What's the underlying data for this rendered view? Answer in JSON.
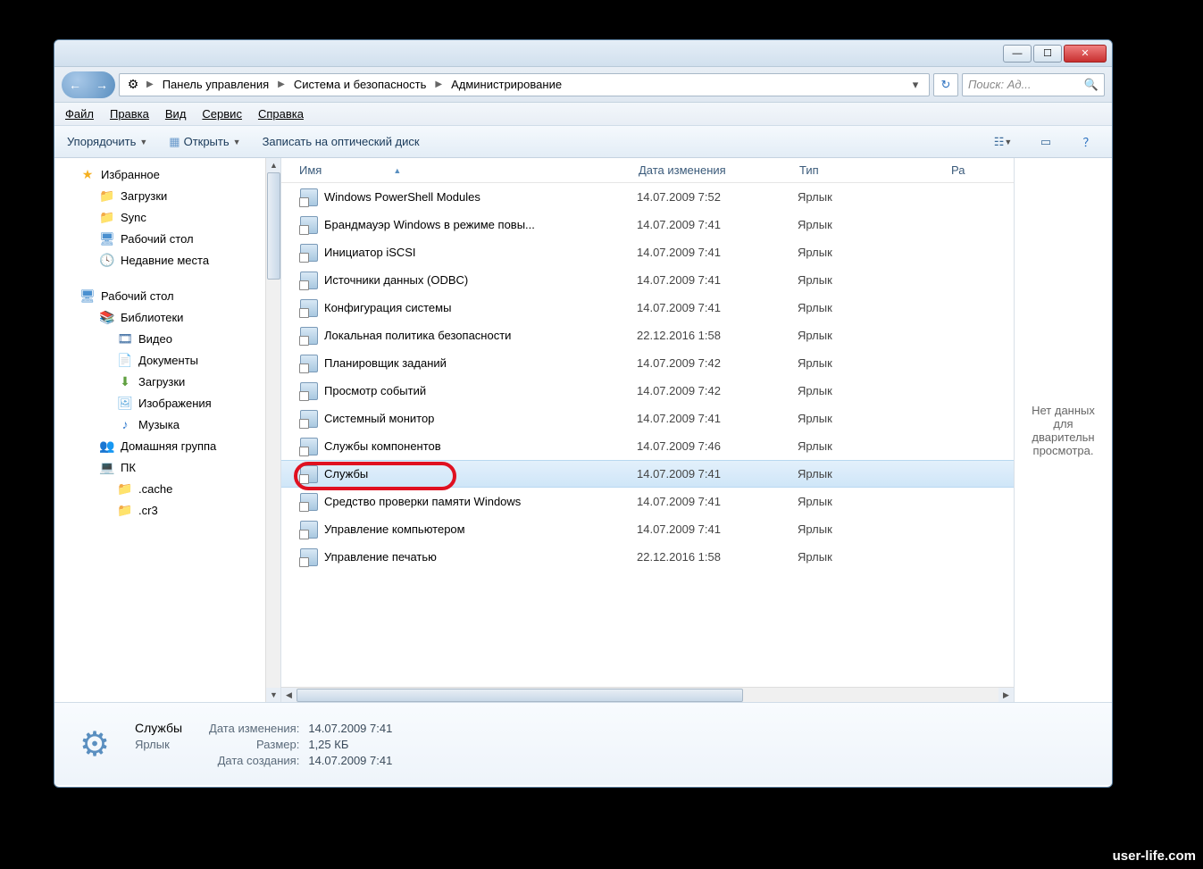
{
  "breadcrumb": {
    "seg1": "Панель управления",
    "seg2": "Система и безопасность",
    "seg3": "Администрирование"
  },
  "search": {
    "placeholder": "Поиск: Ад..."
  },
  "menu": {
    "file": "Файл",
    "edit": "Правка",
    "view": "Вид",
    "service": "Сервис",
    "help": "Справка"
  },
  "toolbar": {
    "organize": "Упорядочить",
    "open": "Открыть",
    "burn": "Записать на оптический диск"
  },
  "columns": {
    "name": "Имя",
    "date": "Дата изменения",
    "type": "Тип",
    "size": "Ра"
  },
  "sidebar": {
    "fav": "Избранное",
    "dl": "Загрузки",
    "sync": "Sync",
    "desk": "Рабочий стол",
    "recent": "Недавние места",
    "desk2": "Рабочий стол",
    "lib": "Библиотеки",
    "vid": "Видео",
    "doc": "Документы",
    "dl2": "Загрузки",
    "img": "Изображения",
    "mus": "Музыка",
    "hg": "Домашняя группа",
    "pc": "ПК",
    "cache": ".cache",
    "cr3": ".cr3"
  },
  "files": [
    {
      "name": "Windows PowerShell Modules",
      "date": "14.07.2009 7:52",
      "type": "Ярлык"
    },
    {
      "name": "Брандмауэр Windows в режиме повы...",
      "date": "14.07.2009 7:41",
      "type": "Ярлык"
    },
    {
      "name": "Инициатор iSCSI",
      "date": "14.07.2009 7:41",
      "type": "Ярлык"
    },
    {
      "name": "Источники данных (ODBC)",
      "date": "14.07.2009 7:41",
      "type": "Ярлык"
    },
    {
      "name": "Конфигурация системы",
      "date": "14.07.2009 7:41",
      "type": "Ярлык"
    },
    {
      "name": "Локальная политика безопасности",
      "date": "22.12.2016 1:58",
      "type": "Ярлык"
    },
    {
      "name": "Планировщик заданий",
      "date": "14.07.2009 7:42",
      "type": "Ярлык"
    },
    {
      "name": "Просмотр событий",
      "date": "14.07.2009 7:42",
      "type": "Ярлык"
    },
    {
      "name": "Системный монитор",
      "date": "14.07.2009 7:41",
      "type": "Ярлык"
    },
    {
      "name": "Службы компонентов",
      "date": "14.07.2009 7:46",
      "type": "Ярлык"
    },
    {
      "name": "Службы",
      "date": "14.07.2009 7:41",
      "type": "Ярлык",
      "sel": true
    },
    {
      "name": "Средство проверки памяти Windows",
      "date": "14.07.2009 7:41",
      "type": "Ярлык"
    },
    {
      "name": "Управление компьютером",
      "date": "14.07.2009 7:41",
      "type": "Ярлык"
    },
    {
      "name": "Управление печатью",
      "date": "22.12.2016 1:58",
      "type": "Ярлык"
    }
  ],
  "preview": {
    "text": "Нет данных для дварительн просмотра."
  },
  "details": {
    "name": "Службы",
    "kind": "Ярлык",
    "modLabel": "Дата изменения:",
    "modVal": "14.07.2009 7:41",
    "sizeLabel": "Размер:",
    "sizeVal": "1,25 КБ",
    "createdLabel": "Дата создания:",
    "createdVal": "14.07.2009 7:41"
  },
  "watermark": "user-life.com"
}
